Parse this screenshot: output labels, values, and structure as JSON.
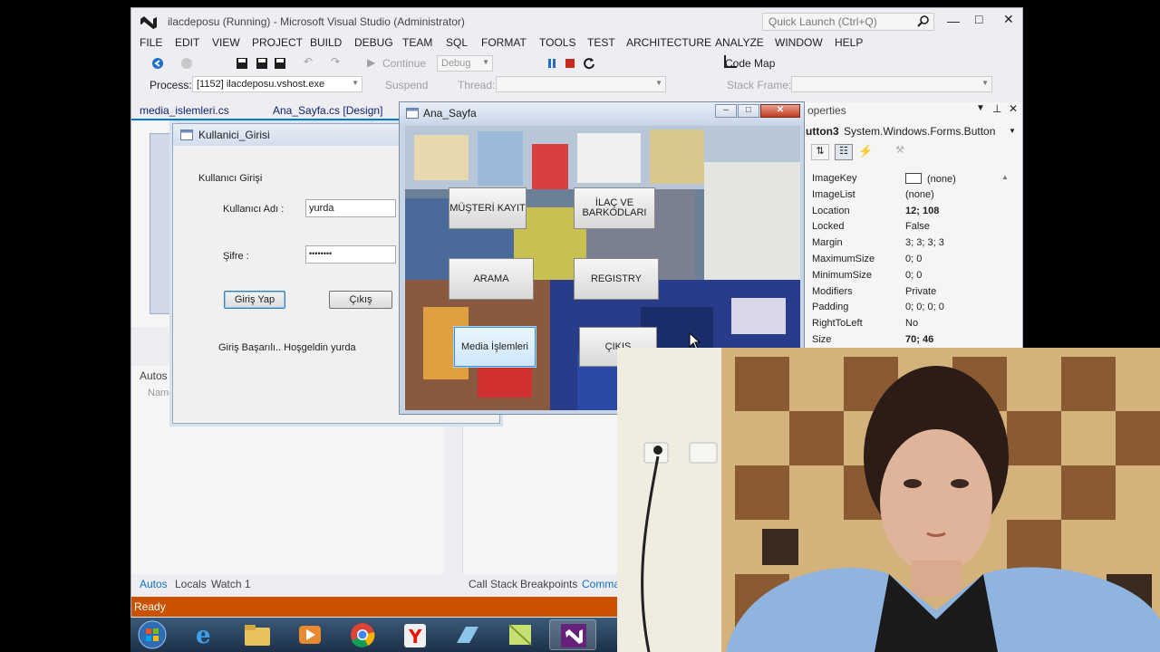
{
  "vs": {
    "title": "ilacdeposu (Running) - Microsoft Visual Studio (Administrator)",
    "quick_launch_placeholder": "Quick Launch (Ctrl+Q)",
    "menu": [
      "FILE",
      "EDIT",
      "VIEW",
      "PROJECT",
      "BUILD",
      "DEBUG",
      "TEAM",
      "SQL",
      "FORMAT",
      "TOOLS",
      "TEST",
      "ARCHITECTURE",
      "ANALYZE",
      "WINDOW",
      "HELP"
    ],
    "toolbar": {
      "continue_label": "Continue",
      "config_label": "Debug",
      "code_map_label": "Code Map",
      "process_label": "Process:",
      "process_value": "[1152] ilacdeposu.vshost.exe",
      "suspend_label": "Suspend",
      "thread_label": "Thread:",
      "stack_frame_label": "Stack Frame:"
    },
    "doc_tabs": [
      "media_islemleri.cs",
      "Ana_Sayfa.cs [Design]"
    ],
    "autos": {
      "title": "Autos",
      "name_col": "Name"
    },
    "bottom_tabs": [
      "Autos",
      "Locals",
      "Watch 1",
      "Call Stack",
      "Breakpoints",
      "Comma"
    ],
    "status": "Ready",
    "properties": {
      "title": "operties",
      "object": "utton3",
      "object_type": "System.Windows.Forms.Button",
      "rows": [
        {
          "name": "ImageKey",
          "value": "(none)",
          "swatch": true,
          "bold": false
        },
        {
          "name": "ImageList",
          "value": "(none)",
          "swatch": false,
          "bold": false
        },
        {
          "name": "Location",
          "value": "12; 108",
          "swatch": false,
          "bold": true
        },
        {
          "name": "Locked",
          "value": "False",
          "swatch": false,
          "bold": false
        },
        {
          "name": "Margin",
          "value": "3; 3; 3; 3",
          "swatch": false,
          "bold": false
        },
        {
          "name": "MaximumSize",
          "value": "0; 0",
          "swatch": false,
          "bold": false
        },
        {
          "name": "MinimumSize",
          "value": "0; 0",
          "swatch": false,
          "bold": false
        },
        {
          "name": "Modifiers",
          "value": "Private",
          "swatch": false,
          "bold": false
        },
        {
          "name": "Padding",
          "value": "0; 0; 0; 0",
          "swatch": false,
          "bold": false
        },
        {
          "name": "RightToLeft",
          "value": "No",
          "swatch": false,
          "bold": false
        },
        {
          "name": "Size",
          "value": "70; 46",
          "swatch": false,
          "bold": true
        }
      ]
    }
  },
  "login": {
    "title": "Kullanici_Girisi",
    "group_label": "Kullanıcı Girişi",
    "username_label": "Kullanıcı Adı :",
    "username_value": "yurda",
    "password_label": "Şifre :",
    "password_value": "••••••••",
    "login_button": "Giriş Yap",
    "exit_button": "Çıkış",
    "message": "Giriş Başarılı.. Hoşgeldin yurda"
  },
  "ana": {
    "title": "Ana_Sayfa",
    "buttons": {
      "musteri": "MÜŞTERİ KAYIT",
      "ilac_line1": "İLAÇ VE",
      "ilac_line2": "BARKODLARI",
      "arama": "ARAMA",
      "registry": "REGISTRY",
      "media": "Media İşlemleri",
      "cikis": "ÇIKIŞ"
    }
  },
  "colors": {
    "vs_accent": "#007acc",
    "status_bar": "#ca5100"
  },
  "icons": [
    "vs-logo-icon",
    "search-icon",
    "back-icon",
    "save-icon",
    "pause-icon",
    "stop-icon",
    "restart-icon",
    "close-icon",
    "form-icon",
    "cursor-icon"
  ]
}
